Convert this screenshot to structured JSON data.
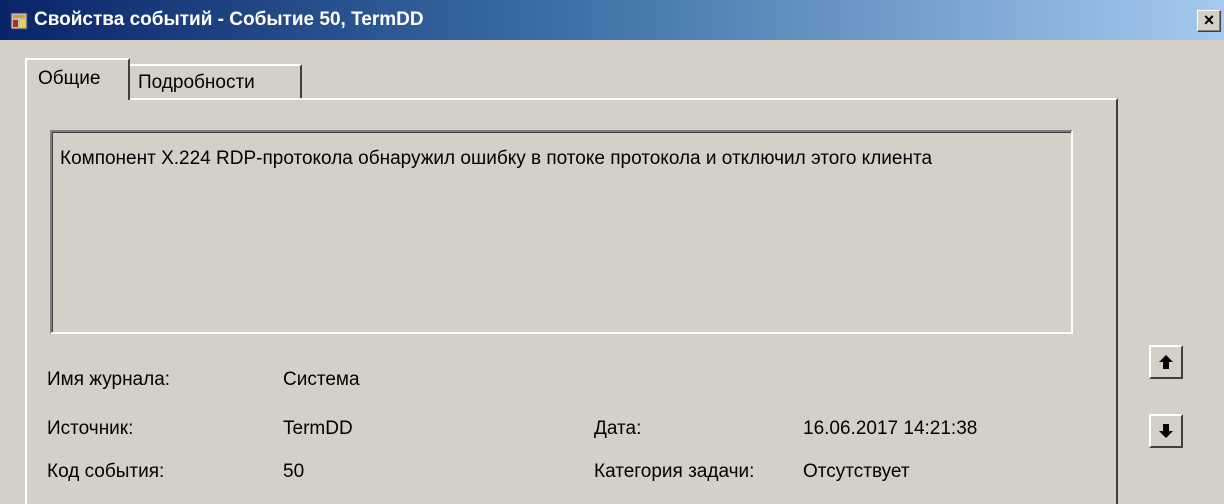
{
  "window": {
    "title": "Свойства событий - Событие 50, TermDD",
    "close_label": "×"
  },
  "tabs": [
    {
      "label": "Общие",
      "selected": true
    },
    {
      "label": "Подробности",
      "selected": false
    }
  ],
  "general": {
    "message": "Компонент X.224 RDP-протокола обнаружил ошибку в потоке протокола и отключил этого клиента",
    "fields": {
      "log_name": {
        "label": "Имя журнала:",
        "value": "Система"
      },
      "source": {
        "label": "Источник:",
        "value": "TermDD"
      },
      "event_id": {
        "label": "Код события:",
        "value": "50"
      },
      "date": {
        "label": "Дата:",
        "value": "16.06.2017 14:21:38"
      },
      "task_category": {
        "label": "Категория задачи:",
        "value": "Отсутствует"
      }
    }
  },
  "nav": {
    "up_icon": "arrow-up-icon",
    "down_icon": "arrow-down-icon"
  },
  "colors": {
    "titlebar_start": "#0a246a",
    "titlebar_end": "#a6caf0",
    "face": "#d4d0c8"
  }
}
